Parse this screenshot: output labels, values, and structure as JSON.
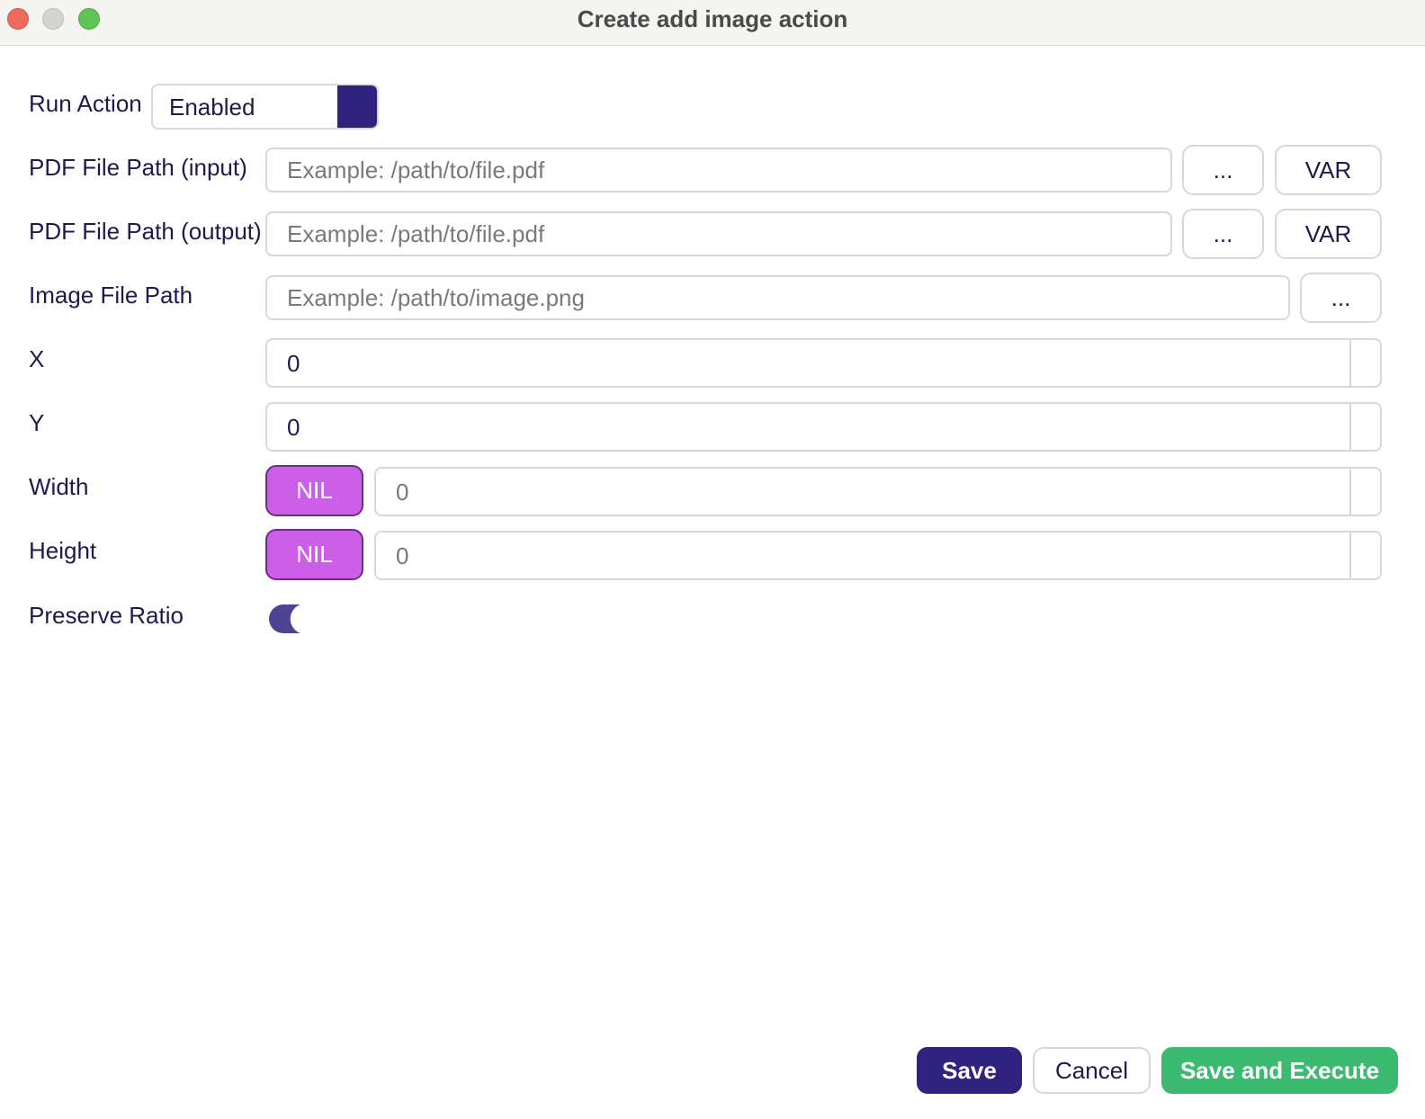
{
  "window": {
    "title": "Create add image action"
  },
  "run_action": {
    "label": "Run Action",
    "value": "Enabled"
  },
  "pdf_input": {
    "label": "PDF File Path (input)",
    "placeholder": "Example: /path/to/file.pdf",
    "browse_label": "...",
    "var_label": "VAR"
  },
  "pdf_output": {
    "label": "PDF File Path (output)",
    "placeholder": "Example: /path/to/file.pdf",
    "browse_label": "...",
    "var_label": "VAR"
  },
  "image_path": {
    "label": "Image File Path",
    "placeholder": "Example: /path/to/image.png",
    "browse_label": "..."
  },
  "x": {
    "label": "X",
    "value": "0"
  },
  "y": {
    "label": "Y",
    "value": "0"
  },
  "width": {
    "label": "Width",
    "nil_label": "NIL",
    "value": "0"
  },
  "height": {
    "label": "Height",
    "nil_label": "NIL",
    "value": "0"
  },
  "preserve_ratio": {
    "label": "Preserve Ratio",
    "enabled": true
  },
  "footer": {
    "save_label": "Save",
    "cancel_label": "Cancel",
    "save_execute_label": "Save and Execute"
  },
  "colors": {
    "primary": "#30237f",
    "nil": "#cc5ee8",
    "execute": "#3cba72",
    "toggle": "#4e4494"
  },
  "icons": {
    "window_controls": [
      "close-icon",
      "minimize-icon",
      "maximize-icon"
    ]
  }
}
